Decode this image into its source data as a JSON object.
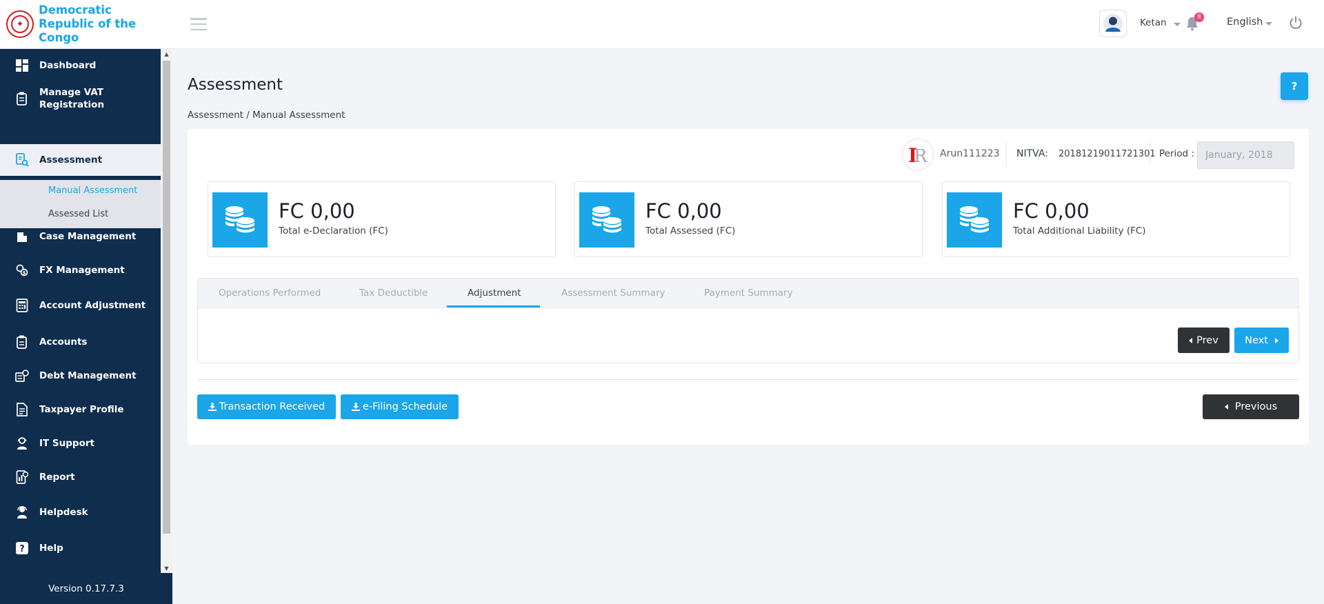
{
  "brand": {
    "line1": "Democratic",
    "line2": "Republic of the Congo",
    "emblem_color": "#d71920",
    "text_color": "#1aa6e8"
  },
  "sidebar": {
    "items": [
      {
        "label": "Dashboard",
        "icon": "dashboard-icon"
      },
      {
        "label": "Manage VAT Registration",
        "icon": "registration-icon"
      },
      {
        "label": "Assessment",
        "icon": "assessment-icon",
        "active": true
      },
      {
        "label": "Case Management",
        "icon": "case-icon"
      },
      {
        "label": "FX Management",
        "icon": "fx-icon"
      },
      {
        "label": "Account Adjustment",
        "icon": "adjustment-icon"
      },
      {
        "label": "Accounts",
        "icon": "accounts-icon"
      },
      {
        "label": "Debt Management",
        "icon": "debt-icon"
      },
      {
        "label": "Taxpayer Profile",
        "icon": "profile-icon"
      },
      {
        "label": "IT Support",
        "icon": "support-icon"
      },
      {
        "label": "Report",
        "icon": "report-icon"
      },
      {
        "label": "Helpdesk",
        "icon": "helpdesk-icon"
      },
      {
        "label": "Help",
        "icon": "help-icon"
      }
    ],
    "submenu": [
      {
        "label": "Manual Assessment",
        "current": true
      },
      {
        "label": "Assessed List"
      }
    ],
    "version": "Version 0.17.7.3",
    "bg_color": "#0f2d4d"
  },
  "header": {
    "user_name": "Ketan",
    "notification_count": "8",
    "language": "English"
  },
  "page": {
    "title": "Assessment",
    "help_label": "?",
    "breadcrumb": "Assessment / Manual Assessment"
  },
  "taxpayer": {
    "name": "Arun111223",
    "nitva_label": "NITVA:",
    "nitva_value": "20181219011721301",
    "period_label": "Period :",
    "period_value": "January, 2018"
  },
  "stats": [
    {
      "value": "FC 0,00",
      "label": "Total e-Declaration (FC)",
      "icon": "coins-icon"
    },
    {
      "value": "FC 0,00",
      "label": "Total Assessed (FC)",
      "icon": "coins-icon"
    },
    {
      "value": "FC 0,00",
      "label": "Total Additional Liability (FC)",
      "icon": "coins-icon"
    }
  ],
  "tabs": [
    {
      "label": "Operations Performed"
    },
    {
      "label": "Tax Deductible"
    },
    {
      "label": "Adjustment",
      "active": true
    },
    {
      "label": "Assessment Summary"
    },
    {
      "label": "Payment Summary"
    }
  ],
  "buttons": {
    "prev": "Prev",
    "next": "Next",
    "transaction_received": "Transaction Received",
    "efiling_schedule": "e-Filing Schedule",
    "previous": "Previous"
  },
  "colors": {
    "accent": "#1aa6e8",
    "dark_button": "#2f3336",
    "background": "#f3f4f8"
  }
}
